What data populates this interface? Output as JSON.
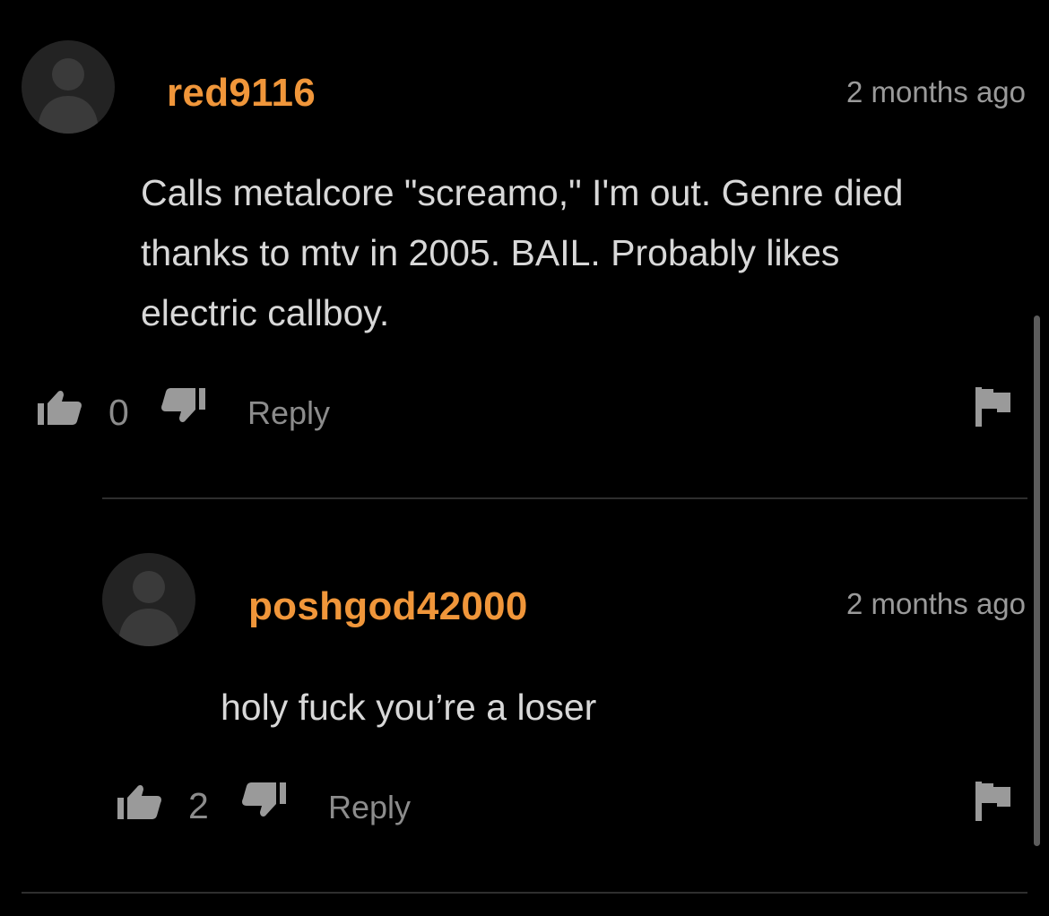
{
  "comments": [
    {
      "username": "red9116",
      "timestamp": "2 months ago",
      "body_lines": [
        "Calls metalcore \"screamo,\" I'm out. Genre died",
        "thanks to mtv in 2005. BAIL. Probably likes",
        "electric callboy."
      ],
      "votes": "0",
      "reply_label": "Reply"
    },
    {
      "username": "poshgod42000",
      "timestamp": "2 months ago",
      "body_lines": [
        "holy fuck you’re a loser"
      ],
      "votes": "2",
      "reply_label": "Reply"
    }
  ],
  "icons": {
    "avatar": "user-silhouette-icon",
    "upvote": "thumbs-up-icon",
    "downvote": "thumbs-down-icon",
    "report": "flag-icon"
  },
  "colors": {
    "background": "#000000",
    "username": "#f0963a",
    "body_text": "#d8d8d8",
    "muted_text": "#9a9a9a"
  }
}
